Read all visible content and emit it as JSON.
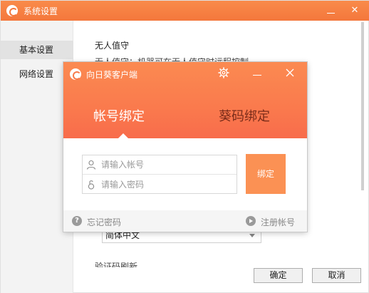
{
  "settings_window": {
    "title": "系统设置",
    "close_glyph": "✕",
    "sidebar": {
      "items": [
        {
          "label": "基本设置",
          "selected": true
        },
        {
          "label": "网络设置",
          "selected": false
        }
      ]
    },
    "content": {
      "heading": "无人值守",
      "partial_text": "无人值守：机器可在无人值守时远程控制",
      "language_select_value": "简体中文",
      "partial_text_bottom": "验证码刷新"
    },
    "buttons": {
      "ok": "确定",
      "cancel": "取消"
    }
  },
  "client_dialog": {
    "title": "向日葵客户端",
    "tabs": [
      {
        "label": "帐号绑定",
        "active": true
      },
      {
        "label": "葵码绑定",
        "active": false
      }
    ],
    "account_placeholder": "请输入帐号",
    "password_placeholder": "请输入密码",
    "bind_button": "绑定",
    "footer": {
      "forgot_password": "忘记密码",
      "help_glyph": "?",
      "register": "注册帐号"
    }
  },
  "colors": {
    "titlebar_orange": "#f4773c",
    "header_gradient_top": "#fb8a51",
    "header_gradient_bottom": "#f86c4c",
    "bind_button": "#fb9154",
    "inactive_tab_text": "#7a2c1a"
  },
  "icons": [
    "sunflower-logo-icon",
    "gear-icon",
    "minimize-icon",
    "close-icon",
    "user-icon",
    "lock-icon",
    "help-icon",
    "register-arrow-icon",
    "dropdown-arrow-icon"
  ]
}
